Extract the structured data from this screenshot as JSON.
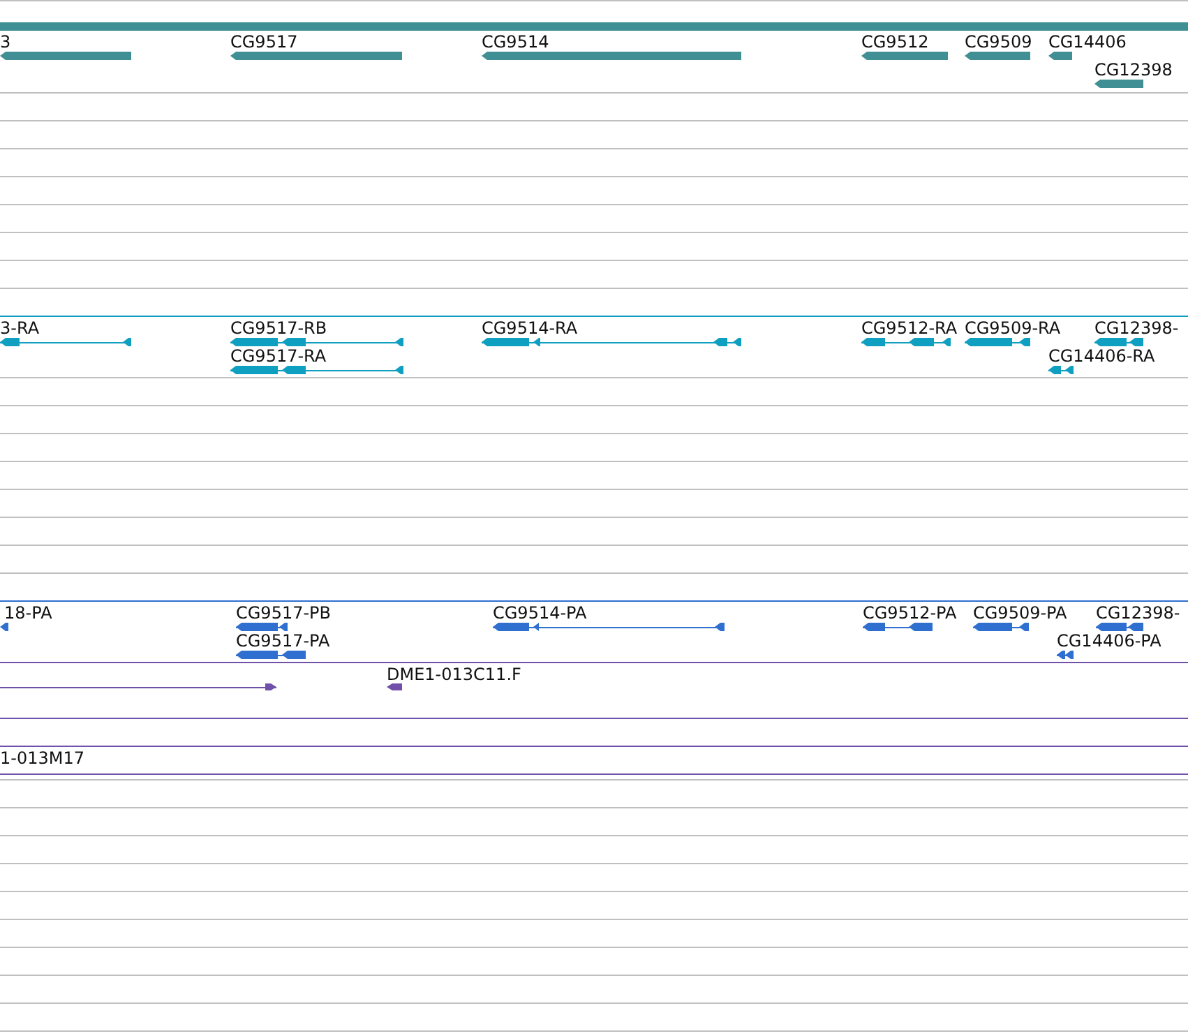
{
  "tracks": [
    {
      "kind": "gene",
      "color": "#3f8f94",
      "features": [
        {
          "label": "3",
          "reverse_strand": true
        },
        {
          "label": "CG9517",
          "reverse_strand": true
        },
        {
          "label": "CG9514",
          "reverse_strand": true
        },
        {
          "label": "CG9512",
          "reverse_strand": true
        },
        {
          "label": "CG9509",
          "reverse_strand": true
        },
        {
          "label": "CG14406",
          "reverse_strand": true
        },
        {
          "label": "CG12398",
          "reverse_strand": true
        }
      ]
    },
    {
      "kind": "transcript",
      "color": "#0f9fc0",
      "features": [
        {
          "label": "3-RA",
          "reverse_strand": true
        },
        {
          "label": "CG9517-RB",
          "reverse_strand": true
        },
        {
          "label": "CG9514-RA",
          "reverse_strand": true
        },
        {
          "label": "CG9512-RA",
          "reverse_strand": true
        },
        {
          "label": "CG9509-RA",
          "reverse_strand": true
        },
        {
          "label": "CG12398-",
          "reverse_strand": true
        },
        {
          "label": "CG9517-RA",
          "reverse_strand": true
        },
        {
          "label": "CG14406-RA",
          "reverse_strand": true
        }
      ]
    },
    {
      "kind": "protein",
      "color": "#2f6fd0",
      "features": [
        {
          "label": "18-PA",
          "reverse_strand": true
        },
        {
          "label": "CG9517-PB",
          "reverse_strand": true
        },
        {
          "label": "CG9514-PA",
          "reverse_strand": true
        },
        {
          "label": "CG9512-PA",
          "reverse_strand": true
        },
        {
          "label": "CG9509-PA",
          "reverse_strand": true
        },
        {
          "label": "CG12398-",
          "reverse_strand": true
        },
        {
          "label": "CG9517-PA",
          "reverse_strand": true
        },
        {
          "label": "CG14406-PA",
          "reverse_strand": true
        }
      ]
    },
    {
      "kind": "clone",
      "color": "#7050a8",
      "features": [
        {
          "reverse_strand": false
        },
        {
          "label": "DME1-013C11.F",
          "reverse_strand": true
        }
      ]
    },
    {
      "kind": "clone",
      "features": [
        {
          "label": "1-013M17"
        }
      ]
    }
  ]
}
